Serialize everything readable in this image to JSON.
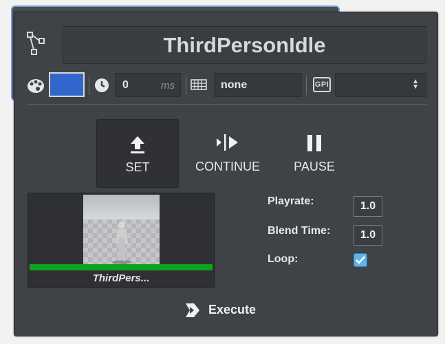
{
  "node": {
    "title": "ThirdPersonIdle",
    "icon": "node-graph-icon"
  },
  "toolbar": {
    "color": "#3366cc",
    "delay_value": "0",
    "delay_unit": "ms",
    "channel_value": "none",
    "gpi_label": "GPI",
    "gpi_selected": ""
  },
  "controls": {
    "set_label": "SET",
    "continue_label": "CONTINUE",
    "pause_label": "PAUSE"
  },
  "preview": {
    "caption": "ThirdPers...",
    "progress_color": "#0ea31a"
  },
  "properties": {
    "playrate_label": "Playrate:",
    "playrate_value": "1.0",
    "blend_label": "Blend Time:",
    "blend_value": "1.0",
    "loop_label": "Loop:",
    "loop_checked": true
  },
  "execute_label": "Execute"
}
